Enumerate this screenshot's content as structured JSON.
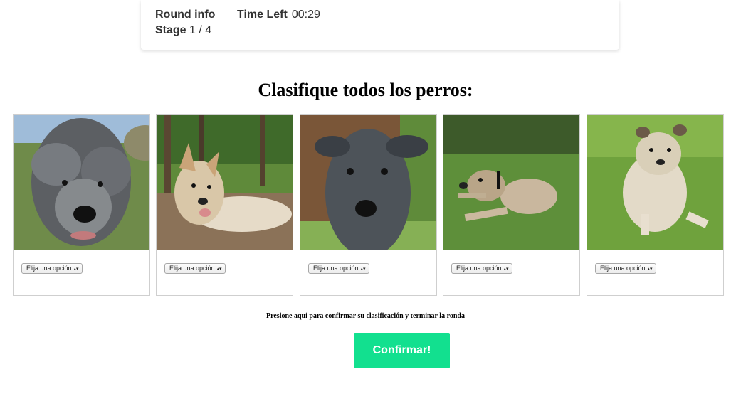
{
  "round_info": {
    "title": "Round info",
    "stage_label": "Stage",
    "stage_value": "1 / 4",
    "time_label": "Time Left",
    "time_value": "00:29"
  },
  "heading": "Clasifique todos los perros:",
  "dogs": [
    {
      "select_value": "Elija una opción",
      "icon": "dog-photo-scruffy-grey"
    },
    {
      "select_value": "Elija una opción",
      "icon": "dog-photo-tan-lying-forest"
    },
    {
      "select_value": "Elija una opción",
      "icon": "dog-photo-grey-puppy"
    },
    {
      "select_value": "Elija una opción",
      "icon": "dog-photo-lying-grass"
    },
    {
      "select_value": "Elija una opción",
      "icon": "dog-photo-cream-lying-grass"
    }
  ],
  "confirm_text": "Presione aquí para confirmar su clasificación y terminar la ronda",
  "confirm_button": "Confirmar!",
  "colors": {
    "accent": "#12e08f"
  }
}
